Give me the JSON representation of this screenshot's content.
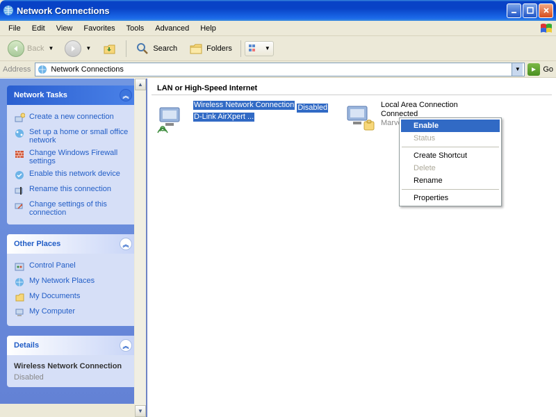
{
  "window": {
    "title": "Network Connections"
  },
  "menubar": [
    "File",
    "Edit",
    "View",
    "Favorites",
    "Tools",
    "Advanced",
    "Help"
  ],
  "toolbar": {
    "back": "Back",
    "search": "Search",
    "folders": "Folders"
  },
  "addressbar": {
    "label": "Address",
    "value": "Network Connections",
    "go": "Go"
  },
  "sidepanel": {
    "tasks_title": "Network Tasks",
    "tasks": [
      "Create a new connection",
      "Set up a home or small office network",
      "Change Windows Firewall settings",
      "Enable this network device",
      "Rename this connection",
      "Change settings of this connection"
    ],
    "places_title": "Other Places",
    "places": [
      "Control Panel",
      "My Network Places",
      "My Documents",
      "My Computer"
    ],
    "details_title": "Details",
    "details_name": "Wireless Network Connection",
    "details_status": "Disabled"
  },
  "content": {
    "section": "LAN or High-Speed Internet",
    "items": [
      {
        "name": "Wireless Network Connection",
        "status": "Disabled",
        "device": "D-Link AirXpert ...",
        "selected": true,
        "type": "wireless"
      },
      {
        "name": "Local Area Connection",
        "status": "Connected",
        "device": "Marvell Yukon 88E8001/8003/...",
        "selected": false,
        "type": "wired"
      }
    ]
  },
  "contextmenu": {
    "items": [
      {
        "label": "Enable",
        "highlighted": true
      },
      {
        "label": "Status",
        "disabled": true
      },
      {
        "sep": true
      },
      {
        "label": "Create Shortcut"
      },
      {
        "label": "Delete",
        "disabled": true
      },
      {
        "label": "Rename"
      },
      {
        "sep": true
      },
      {
        "label": "Properties"
      }
    ]
  }
}
